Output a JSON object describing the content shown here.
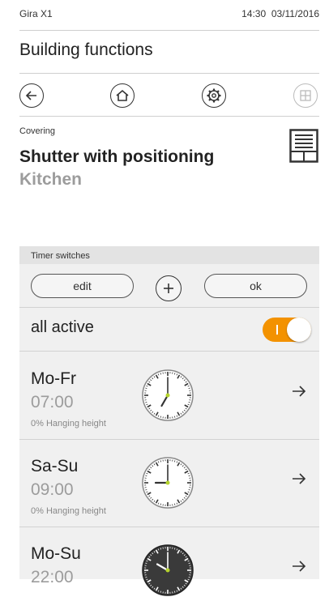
{
  "statusbar": {
    "device": "Gira X1",
    "time": "14:30",
    "date": "03/11/2016"
  },
  "page_title": "Building functions",
  "nav": {
    "back_icon": "arrow-left-icon",
    "home_icon": "home-icon",
    "settings_icon": "gear-icon",
    "grid_icon": "grid-icon"
  },
  "function": {
    "category": "Covering",
    "name": "Shutter with positioning",
    "room": "Kitchen",
    "icon": "shutter-icon"
  },
  "timer_panel": {
    "header": "Timer switches",
    "edit_label": "edit",
    "ok_label": "ok",
    "all_active_label": "all active",
    "all_active_on": true,
    "accent": "#f39200",
    "timers": [
      {
        "days": "Mo-Fr",
        "time": "07:00",
        "position": "0% Hanging height",
        "hour": 7,
        "minute": 0,
        "dark": false
      },
      {
        "days": "Sa-Su",
        "time": "09:00",
        "position": "0% Hanging height",
        "hour": 9,
        "minute": 0,
        "dark": false
      },
      {
        "days": "Mo-Su",
        "time": "22:00",
        "position": "",
        "hour": 22,
        "minute": 0,
        "dark": true
      }
    ]
  }
}
